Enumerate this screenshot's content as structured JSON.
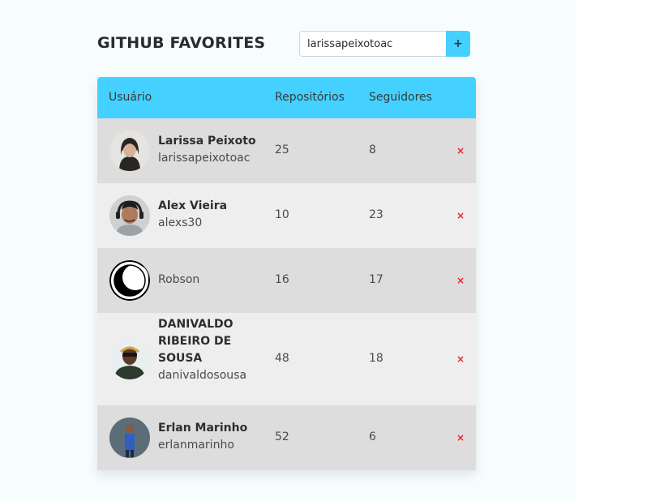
{
  "header": {
    "title": "GITHUB FAVORITES",
    "search_value": "larissapeixotoac",
    "add_label": "+"
  },
  "table": {
    "columns": [
      "Usuário",
      "Repositórios",
      "Seguidores"
    ],
    "remove_label": "×",
    "rows": [
      {
        "name": "Larissa Peixoto",
        "login": "larissapeixotoac",
        "repos": "25",
        "followers": "8",
        "avatar_icon": "avatar-larissa"
      },
      {
        "name": "Alex Vieira",
        "login": "alexs30",
        "repos": "10",
        "followers": "23",
        "avatar_icon": "avatar-alex"
      },
      {
        "name": "",
        "login": "Robson",
        "repos": "16",
        "followers": "17",
        "avatar_icon": "avatar-robson"
      },
      {
        "name": "DANIVALDO RIBEIRO DE SOUSA",
        "login": "danivaldosousa",
        "repos": "48",
        "followers": "18",
        "avatar_icon": "avatar-danivaldo"
      },
      {
        "name": "Erlan Marinho",
        "login": "erlanmarinho",
        "repos": "52",
        "followers": "6",
        "avatar_icon": "avatar-erlan"
      }
    ]
  },
  "colors": {
    "accent": "#44d1ff",
    "row_odd": "#dddddd",
    "row_even": "#eeeeee",
    "remove": "#e8233a"
  }
}
